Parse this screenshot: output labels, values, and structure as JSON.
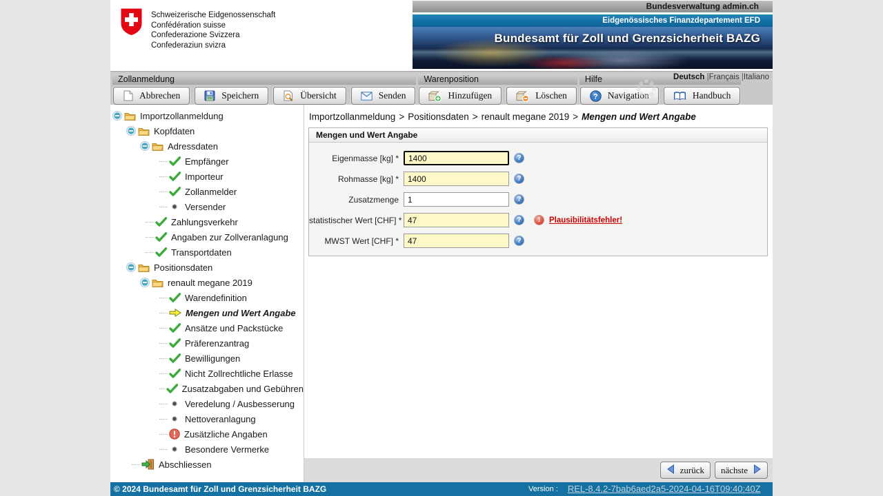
{
  "header": {
    "logo_lines": [
      "Schweizerische Eidgenossenschaft",
      "Confédération suisse",
      "Confederazione Svizzera",
      "Confederaziun svizra"
    ],
    "gov_bar": "Bundesverwaltung admin.ch",
    "dept_bar": "Eidgenössisches Finanzdepartement EFD",
    "office_title": "Bundesamt für Zoll und Grenzsicherheit BAZG"
  },
  "toolbar": {
    "groups": [
      {
        "label": "Zollanmeldung",
        "buttons": [
          {
            "label": "Abbrechen",
            "icon": "cancel-page-icon"
          },
          {
            "label": "Speichern",
            "icon": "save-floppy-icon"
          },
          {
            "label": "Übersicht",
            "icon": "overview-magnifier-icon"
          },
          {
            "label": "Senden",
            "icon": "send-envelope-icon"
          }
        ]
      },
      {
        "label": "Warenposition",
        "buttons": [
          {
            "label": "Hinzufügen",
            "icon": "add-package-icon"
          },
          {
            "label": "Löschen",
            "icon": "delete-package-icon"
          }
        ]
      },
      {
        "label": "Hilfe",
        "buttons": [
          {
            "label": "Navigation",
            "icon": "question-sphere-icon"
          },
          {
            "label": "Handbuch",
            "icon": "book-icon"
          }
        ]
      }
    ],
    "languages": [
      {
        "label": "Deutsch",
        "active": true
      },
      {
        "label": "Français",
        "active": false
      },
      {
        "label": "Italiano",
        "active": false
      }
    ],
    "language_separator": "|"
  },
  "tree": {
    "items": [
      {
        "label": "Importzollanmeldung",
        "level": 0,
        "icon": "folder",
        "expander": true
      },
      {
        "label": "Kopfdaten",
        "level": 1,
        "icon": "folder",
        "expander": true
      },
      {
        "label": "Adressdaten",
        "level": 2,
        "icon": "folder",
        "expander": true
      },
      {
        "label": "Empfänger",
        "level": 3,
        "icon": "check"
      },
      {
        "label": "Importeur",
        "level": 3,
        "icon": "check"
      },
      {
        "label": "Zollanmelder",
        "level": 3,
        "icon": "check"
      },
      {
        "label": "Versender",
        "level": 3,
        "icon": "bullet"
      },
      {
        "label": "Zahlungsverkehr",
        "level": 2,
        "icon": "check"
      },
      {
        "label": "Angaben zur Zollveranlagung",
        "level": 2,
        "icon": "check"
      },
      {
        "label": "Transportdaten",
        "level": 2,
        "icon": "check"
      },
      {
        "label": "Positionsdaten",
        "level": 1,
        "icon": "folder",
        "expander": true
      },
      {
        "label": "renault megane 2019",
        "level": 2,
        "icon": "folder",
        "expander": true
      },
      {
        "label": "Warendefinition",
        "level": 3,
        "icon": "check"
      },
      {
        "label": "Mengen und Wert Angabe",
        "level": 3,
        "icon": "arrow",
        "current": true
      },
      {
        "label": "Ansätze und Packstücke",
        "level": 3,
        "icon": "check"
      },
      {
        "label": "Präferenzantrag",
        "level": 3,
        "icon": "check"
      },
      {
        "label": "Bewilligungen",
        "level": 3,
        "icon": "check"
      },
      {
        "label": "Nicht Zollrechtliche Erlasse",
        "level": 3,
        "icon": "check"
      },
      {
        "label": "Zusatzabgaben und Gebühren",
        "level": 3,
        "icon": "check"
      },
      {
        "label": "Veredelung / Ausbesserung",
        "level": 3,
        "icon": "bullet"
      },
      {
        "label": "Nettoveranlagung",
        "level": 3,
        "icon": "bullet"
      },
      {
        "label": "Zusätzliche Angaben",
        "level": 3,
        "icon": "error"
      },
      {
        "label": "Besondere Vermerke",
        "level": 3,
        "icon": "bullet"
      },
      {
        "label": "Abschliessen",
        "level": 1,
        "icon": "exit"
      }
    ]
  },
  "breadcrumb": {
    "parts": [
      "Importzollanmeldung",
      "Positionsdaten",
      "renault megane 2019"
    ],
    "current": "Mengen und Wert Angabe",
    "separator": ">"
  },
  "form": {
    "title": "Mengen und Wert Angabe",
    "fields": [
      {
        "label": "Eigenmasse [kg] *",
        "value": "1400",
        "highlight": true,
        "focused": true
      },
      {
        "label": "Rohmasse [kg] *",
        "value": "1400",
        "highlight": true
      },
      {
        "label": "Zusatzmenge",
        "value": "1",
        "highlight": false
      },
      {
        "label": "statistischer Wert [CHF] *",
        "value": "47",
        "highlight": true,
        "error": "Plausibilitätsfehler!"
      },
      {
        "label": "MWST Wert [CHF] *",
        "value": "47",
        "highlight": true
      }
    ]
  },
  "pager": {
    "back": "zurück",
    "next": "nächste"
  },
  "footer": {
    "copyright": "© 2024 Bundesamt für Zoll und Grenzsicherheit BAZG",
    "version_label": "Version :",
    "version": "REL-8.4.2-7bab6aed2a5-2024-04-16T09:40:40Z"
  },
  "colors": {
    "footer_blue": "#1571a1",
    "dept_bar_blue": "#16729f",
    "field_yellow": "#fcf8c8",
    "error_red": "#cc0000",
    "check_green": "#3cab3c",
    "current_arrow_yellow": "#f7ef3e"
  }
}
